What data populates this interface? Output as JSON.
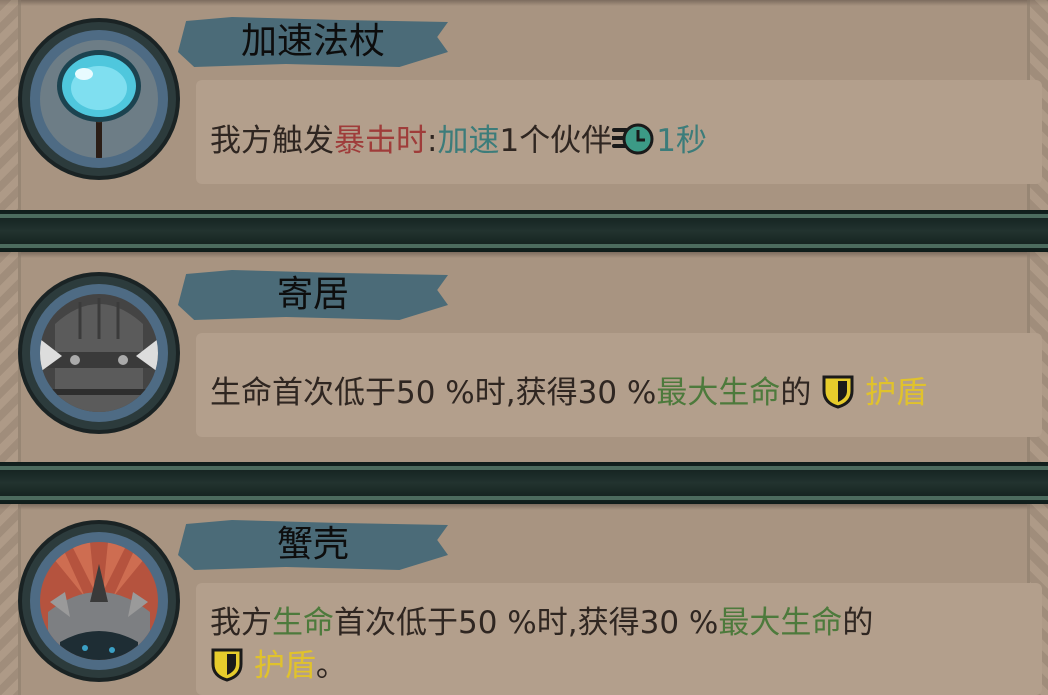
{
  "colors": {
    "panel": "#a89481",
    "banner": "#4b6b78",
    "divider": "#1d2b27",
    "crit_red": "#9f3c3a",
    "speed_teal": "#3c7c7a",
    "life_green": "#4d7a3c",
    "shield_yellow": "#e0c22c"
  },
  "items": [
    {
      "name": "加速法杖",
      "icon": "blue-orb-staff-icon",
      "desc": {
        "p1": "我方触发",
        "crit": "暴击时",
        "colon": ":",
        "haste": "加速",
        "num": "1",
        "target": "个伙伴",
        "speed_icon": "haste-clock-icon",
        "duration": "1秒"
      }
    },
    {
      "name": "寄居",
      "icon": "iron-helmet-icon",
      "desc": {
        "p1": "生命首次低于50 %时,获得30 %",
        "max_hp": "最大生命",
        "of": "的",
        "shield_icon": "shield-icon",
        "shield": "护盾"
      }
    },
    {
      "name": "蟹壳",
      "icon": "spiked-shell-icon",
      "desc": {
        "p1": "我方",
        "hp": "生命",
        "p2": "首次低于50 %时,获得30 %",
        "max_hp": "最大生命",
        "of": "的",
        "shield_icon": "shield-icon",
        "shield": "护盾",
        "end": "。"
      }
    }
  ]
}
